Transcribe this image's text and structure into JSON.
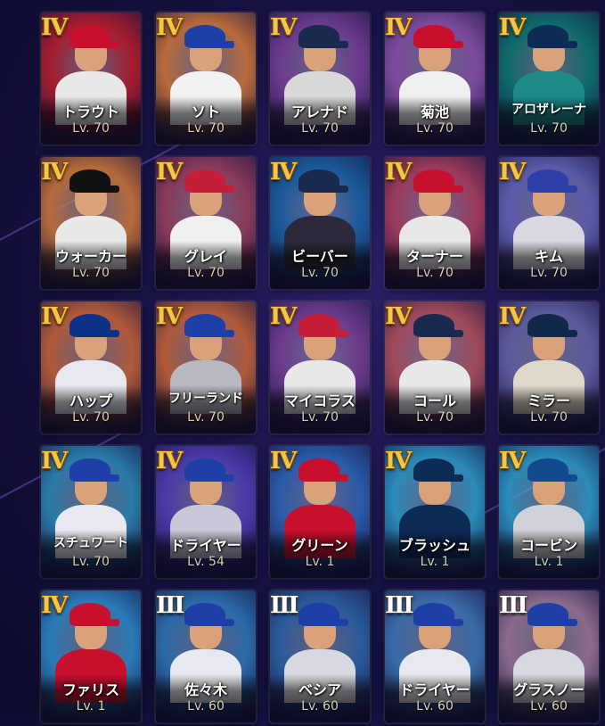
{
  "cards": [
    {
      "tier": "IV",
      "name": "トラウト",
      "level": "Lv. 70",
      "team_color": "#c8102e",
      "bg_color": "#a51c2e",
      "uniform": "#e8e8e8"
    },
    {
      "tier": "IV",
      "name": "ソト",
      "level": "Lv. 70",
      "team_color": "#1e3fa8",
      "bg_color": "#b86a3a",
      "uniform": "#f2f2f2"
    },
    {
      "tier": "IV",
      "name": "アレナド",
      "level": "Lv. 70",
      "team_color": "#1a2a4f",
      "bg_color": "#6a3a8c",
      "uniform": "#d8d8d8"
    },
    {
      "tier": "IV",
      "name": "菊池",
      "level": "Lv. 70",
      "team_color": "#c8102e",
      "bg_color": "#7a4a9a",
      "uniform": "#f0f0f0"
    },
    {
      "tier": "IV",
      "name": "アロザレーナ",
      "level": "Lv. 70",
      "team_color": "#0c2c56",
      "bg_color": "#0f6a6a",
      "uniform": "#1f8a8a"
    },
    {
      "tier": "IV",
      "name": "ウォーカー",
      "level": "Lv. 70",
      "team_color": "#111111",
      "bg_color": "#b56a3a",
      "uniform": "#e8e8e8"
    },
    {
      "tier": "IV",
      "name": "グレイ",
      "level": "Lv. 70",
      "team_color": "#c41e3a",
      "bg_color": "#8a3a5a",
      "uniform": "#f0f0f0"
    },
    {
      "tier": "IV",
      "name": "ビーバー",
      "level": "Lv. 70",
      "team_color": "#1a2a4f",
      "bg_color": "#1a5a9a",
      "uniform": "#2a2a3a"
    },
    {
      "tier": "IV",
      "name": "ターナー",
      "level": "Lv. 70",
      "team_color": "#c8102e",
      "bg_color": "#9a3a5a",
      "uniform": "#e8e8e8"
    },
    {
      "tier": "IV",
      "name": "キム",
      "level": "Lv. 70",
      "team_color": "#2f3fa8",
      "bg_color": "#5a5aa8",
      "uniform": "#d8d8e0"
    },
    {
      "tier": "IV",
      "name": "ハップ",
      "level": "Lv. 70",
      "team_color": "#0e3386",
      "bg_color": "#b05a3a",
      "uniform": "#e8e8f0"
    },
    {
      "tier": "IV",
      "name": "フリーランド",
      "level": "Lv. 70",
      "team_color": "#1e3fa8",
      "bg_color": "#b05a3a",
      "uniform": "#b8b8c0"
    },
    {
      "tier": "IV",
      "name": "マイコラス",
      "level": "Lv. 70",
      "team_color": "#c41e3a",
      "bg_color": "#6a3a8a",
      "uniform": "#e8e8e8"
    },
    {
      "tier": "IV",
      "name": "コール",
      "level": "Lv. 70",
      "team_color": "#1a2a4f",
      "bg_color": "#a04a5a",
      "uniform": "#e8e8e8"
    },
    {
      "tier": "IV",
      "name": "ミラー",
      "level": "Lv. 70",
      "team_color": "#12284b",
      "bg_color": "#5a5a9a",
      "uniform": "#e0d8c8"
    },
    {
      "tier": "IV",
      "name": "スチュワート",
      "level": "Lv. 70",
      "team_color": "#1e3fa8",
      "bg_color": "#2a7aa8",
      "uniform": "#e8e8f0"
    },
    {
      "tier": "IV",
      "name": "ドライヤー",
      "level": "Lv. 54",
      "team_color": "#1e3fa8",
      "bg_color": "#4a3aa8",
      "uniform": "#c8c8d8"
    },
    {
      "tier": "IV",
      "name": "グリーン",
      "level": "Lv. 1",
      "team_color": "#c8102e",
      "bg_color": "#2a5aa8",
      "uniform": "#c8102e"
    },
    {
      "tier": "IV",
      "name": "ブラッシュ",
      "level": "Lv. 1",
      "team_color": "#0c2c56",
      "bg_color": "#2a8ab8",
      "uniform": "#0c2c56"
    },
    {
      "tier": "IV",
      "name": "コービン",
      "level": "Lv. 1",
      "team_color": "#134a8e",
      "bg_color": "#2a8ab8",
      "uniform": "#d0d0d8"
    },
    {
      "tier": "IV",
      "name": "ファリス",
      "level": "Lv. 1",
      "team_color": "#c8102e",
      "bg_color": "#2a7ab8",
      "uniform": "#c8102e"
    },
    {
      "tier": "III",
      "name": "佐々木",
      "level": "Lv. 60",
      "team_color": "#1e3fa8",
      "bg_color": "#2a6aa8",
      "uniform": "#e8e8f0"
    },
    {
      "tier": "III",
      "name": "ベシア",
      "level": "Lv. 60",
      "team_color": "#1e3fa8",
      "bg_color": "#2a5a9a",
      "uniform": "#d8d8e0"
    },
    {
      "tier": "III",
      "name": "ドライヤー",
      "level": "Lv. 60",
      "team_color": "#1e3fa8",
      "bg_color": "#3a6aa8",
      "uniform": "#e8e8f0"
    },
    {
      "tier": "III",
      "name": "グラスノー",
      "level": "Lv. 60",
      "team_color": "#1e3fa8",
      "bg_color": "#8a6a8a",
      "uniform": "#d8d8e0"
    }
  ],
  "colors": {
    "tier_gold": "#f3c54a",
    "tier_silver": "#ffffff",
    "background": "#171243"
  }
}
